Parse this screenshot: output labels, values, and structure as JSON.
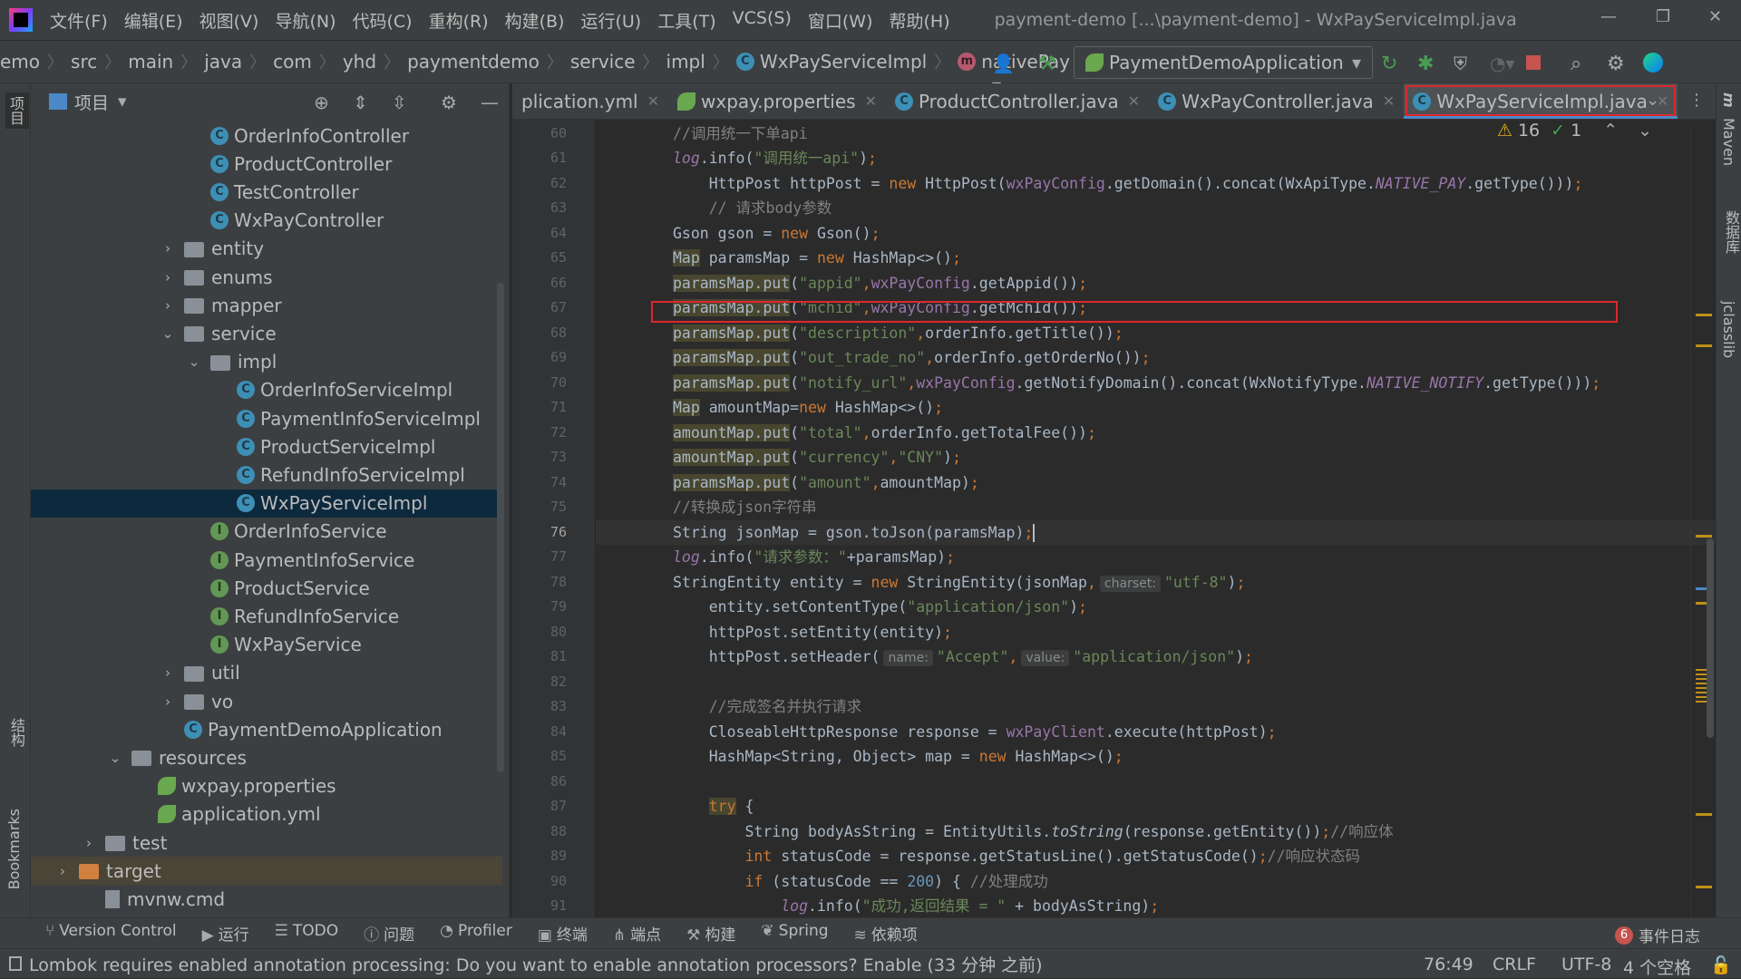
{
  "menubar": {
    "items": [
      "文件(F)",
      "编辑(E)",
      "视图(V)",
      "导航(N)",
      "代码(C)",
      "重构(R)",
      "构建(B)",
      "运行(U)",
      "工具(T)",
      "VCS(S)",
      "窗口(W)",
      "帮助(H)"
    ],
    "title": "payment-demo [...\\payment-demo] - WxPayServiceImpl.java"
  },
  "breadcrumb": {
    "items": [
      "emo",
      "src",
      "main",
      "java",
      "com",
      "yhd",
      "paymentdemo",
      "service",
      "impl"
    ],
    "class_name": "WxPayServiceImpl",
    "method_name": "nativePay"
  },
  "toolbar": {
    "run_config": "PaymentDemoApplication"
  },
  "project_panel": {
    "title": "项目",
    "tree": [
      {
        "label": "OrderInfoController",
        "icon": "class",
        "level": 6
      },
      {
        "label": "ProductController",
        "icon": "class",
        "level": 6
      },
      {
        "label": "TestController",
        "icon": "class",
        "level": 6
      },
      {
        "label": "WxPayController",
        "icon": "class",
        "level": 6
      },
      {
        "label": "entity",
        "icon": "folder",
        "level": 5,
        "arrow": "collapsed"
      },
      {
        "label": "enums",
        "icon": "folder",
        "level": 5,
        "arrow": "collapsed"
      },
      {
        "label": "mapper",
        "icon": "folder",
        "level": 5,
        "arrow": "collapsed"
      },
      {
        "label": "service",
        "icon": "folder",
        "level": 5,
        "arrow": "expanded"
      },
      {
        "label": "impl",
        "icon": "folder",
        "level": 6,
        "arrow": "expanded"
      },
      {
        "label": "OrderInfoServiceImpl",
        "icon": "class",
        "level": 7
      },
      {
        "label": "PaymentInfoServiceImpl",
        "icon": "class",
        "level": 7
      },
      {
        "label": "ProductServiceImpl",
        "icon": "class",
        "level": 7
      },
      {
        "label": "RefundInfoServiceImpl",
        "icon": "class",
        "level": 7
      },
      {
        "label": "WxPayServiceImpl",
        "icon": "class",
        "level": 7,
        "selected": true
      },
      {
        "label": "OrderInfoService",
        "icon": "interface",
        "level": 6
      },
      {
        "label": "PaymentInfoService",
        "icon": "interface",
        "level": 6
      },
      {
        "label": "ProductService",
        "icon": "interface",
        "level": 6
      },
      {
        "label": "RefundInfoService",
        "icon": "interface",
        "level": 6
      },
      {
        "label": "WxPayService",
        "icon": "interface",
        "level": 6
      },
      {
        "label": "util",
        "icon": "folder",
        "level": 5,
        "arrow": "collapsed"
      },
      {
        "label": "vo",
        "icon": "folder",
        "level": 5,
        "arrow": "collapsed"
      },
      {
        "label": "PaymentDemoApplication",
        "icon": "spring-app",
        "level": 5
      },
      {
        "label": "resources",
        "icon": "folder",
        "level": 3,
        "arrow": "expanded"
      },
      {
        "label": "wxpay.properties",
        "icon": "spring-config",
        "level": 4
      },
      {
        "label": "application.yml",
        "icon": "spring-config",
        "level": 4
      },
      {
        "label": "test",
        "icon": "folder",
        "level": 2,
        "arrow": "collapsed"
      },
      {
        "label": "target",
        "icon": "folder-excluded",
        "level": 1,
        "arrow": "collapsed",
        "excluded": true
      },
      {
        "label": "mvnw.cmd",
        "icon": "file",
        "level": 2
      }
    ]
  },
  "tabs": [
    {
      "label": "plication.yml",
      "icon": "none"
    },
    {
      "label": "wxpay.properties",
      "icon": "spring-config"
    },
    {
      "label": "ProductController.java",
      "icon": "class"
    },
    {
      "label": "WxPayController.java",
      "icon": "class"
    },
    {
      "label": "WxPayServiceImpl.java",
      "icon": "class",
      "active": true
    }
  ],
  "editor": {
    "warnings": "16",
    "weak_warnings": "1",
    "current_line": 76,
    "highlighted_line": 70,
    "lines": [
      {
        "n": 60,
        "seg": [
          [
            "c",
            "//调用统一下单api"
          ]
        ]
      },
      {
        "n": 61,
        "seg": [
          [
            "fi",
            "log"
          ],
          [
            "p",
            ".info("
          ],
          [
            "s",
            "\"调用统一api\""
          ],
          [
            "p",
            ")"
          ],
          [
            "k",
            ";"
          ]
        ]
      },
      {
        "n": 62,
        "seg": [
          [
            "p",
            "    HttpPost httpPost = "
          ],
          [
            "k",
            "new"
          ],
          [
            "p",
            " HttpPost("
          ],
          [
            "f",
            "wxPayConfig"
          ],
          [
            "p",
            ".getDomain().concat(WxApiType."
          ],
          [
            "fi",
            "NATIVE_PAY"
          ],
          [
            "p",
            ".getType()))"
          ],
          [
            "k",
            ";"
          ]
        ]
      },
      {
        "n": 63,
        "seg": [
          [
            "c",
            "    // 请求body参数"
          ]
        ]
      },
      {
        "n": 64,
        "seg": [
          [
            "p",
            "Gson gson = "
          ],
          [
            "k",
            "new"
          ],
          [
            "p",
            " Gson()"
          ],
          [
            "k",
            ";"
          ]
        ]
      },
      {
        "n": 65,
        "seg": [
          [
            "hl",
            "Map"
          ],
          [
            "p",
            " paramsMap = "
          ],
          [
            "k",
            "new"
          ],
          [
            "p",
            " HashMap<>()"
          ],
          [
            "k",
            ";"
          ]
        ]
      },
      {
        "n": 66,
        "seg": [
          [
            "hl",
            "paramsMap.put"
          ],
          [
            "p",
            "("
          ],
          [
            "s",
            "\"appid\""
          ],
          [
            "k",
            ","
          ],
          [
            "f",
            "wxPayConfig"
          ],
          [
            "p",
            ".getAppid())"
          ],
          [
            "k",
            ";"
          ]
        ]
      },
      {
        "n": 67,
        "seg": [
          [
            "hl",
            "paramsMap.put"
          ],
          [
            "p",
            "("
          ],
          [
            "s",
            "\"mchid\""
          ],
          [
            "k",
            ","
          ],
          [
            "f",
            "wxPayConfig"
          ],
          [
            "p",
            ".getMchId())"
          ],
          [
            "k",
            ";"
          ]
        ]
      },
      {
        "n": 68,
        "seg": [
          [
            "hl",
            "paramsMap.put"
          ],
          [
            "p",
            "("
          ],
          [
            "s",
            "\"description\""
          ],
          [
            "k",
            ","
          ],
          [
            "p",
            "orderInfo.getTitle())"
          ],
          [
            "k",
            ";"
          ]
        ]
      },
      {
        "n": 69,
        "seg": [
          [
            "hl",
            "paramsMap.put"
          ],
          [
            "p",
            "("
          ],
          [
            "s",
            "\"out_trade_no\""
          ],
          [
            "k",
            ","
          ],
          [
            "p",
            "orderInfo.getOrderNo())"
          ],
          [
            "k",
            ";"
          ]
        ]
      },
      {
        "n": 70,
        "seg": [
          [
            "hl",
            "paramsMap.put"
          ],
          [
            "p",
            "("
          ],
          [
            "s",
            "\"notify_url\""
          ],
          [
            "k",
            ","
          ],
          [
            "f",
            "wxPayConfig"
          ],
          [
            "p",
            ".getNotifyDomain().concat(WxNotifyType."
          ],
          [
            "fi",
            "NATIVE_NOTIFY"
          ],
          [
            "p",
            ".getType()))"
          ],
          [
            "k",
            ";"
          ]
        ]
      },
      {
        "n": 71,
        "seg": [
          [
            "hl",
            "Map"
          ],
          [
            "p",
            " amountMap="
          ],
          [
            "k",
            "new"
          ],
          [
            "p",
            " HashMap<>()"
          ],
          [
            "k",
            ";"
          ]
        ]
      },
      {
        "n": 72,
        "seg": [
          [
            "hl",
            "amountMap.put"
          ],
          [
            "p",
            "("
          ],
          [
            "s",
            "\"total\""
          ],
          [
            "k",
            ","
          ],
          [
            "p",
            "orderInfo.getTotalFee())"
          ],
          [
            "k",
            ";"
          ]
        ]
      },
      {
        "n": 73,
        "seg": [
          [
            "hl",
            "amountMap.put"
          ],
          [
            "p",
            "("
          ],
          [
            "s",
            "\"currency\""
          ],
          [
            "k",
            ","
          ],
          [
            "s",
            "\"CNY\""
          ],
          [
            "p",
            ")"
          ],
          [
            "k",
            ";"
          ]
        ]
      },
      {
        "n": 74,
        "seg": [
          [
            "hl",
            "paramsMap.put"
          ],
          [
            "p",
            "("
          ],
          [
            "s",
            "\"amount\""
          ],
          [
            "k",
            ","
          ],
          [
            "p",
            "amountMap)"
          ],
          [
            "k",
            ";"
          ]
        ]
      },
      {
        "n": 75,
        "seg": [
          [
            "c",
            "//转换成json字符串"
          ]
        ]
      },
      {
        "n": 76,
        "seg": [
          [
            "p",
            "String jsonMap = gson.toJson(paramsMap)"
          ],
          [
            "k",
            ";"
          ]
        ]
      },
      {
        "n": 77,
        "seg": [
          [
            "fi",
            "log"
          ],
          [
            "p",
            ".info("
          ],
          [
            "s",
            "\"请求参数：\""
          ],
          [
            "p",
            "+paramsMap)"
          ],
          [
            "k",
            ";"
          ]
        ]
      },
      {
        "n": 78,
        "seg": [
          [
            "p",
            "StringEntity entity = "
          ],
          [
            "k",
            "new"
          ],
          [
            "p",
            " StringEntity(jsonMap"
          ],
          [
            "k",
            ","
          ],
          [
            "h",
            "charset:"
          ],
          [
            "s",
            "\"utf-8\""
          ],
          [
            "p",
            ")"
          ],
          [
            "k",
            ";"
          ]
        ]
      },
      {
        "n": 79,
        "seg": [
          [
            "p",
            "    entity.setContentType("
          ],
          [
            "s",
            "\"application/json\""
          ],
          [
            "p",
            ")"
          ],
          [
            "k",
            ";"
          ]
        ]
      },
      {
        "n": 80,
        "seg": [
          [
            "p",
            "    httpPost.setEntity(entity)"
          ],
          [
            "k",
            ";"
          ]
        ]
      },
      {
        "n": 81,
        "seg": [
          [
            "p",
            "    httpPost.setHeader("
          ],
          [
            "h",
            "name:"
          ],
          [
            "s",
            "\"Accept\""
          ],
          [
            "k",
            ","
          ],
          [
            "h",
            "value:"
          ],
          [
            "s",
            "\"application/json\""
          ],
          [
            "p",
            ")"
          ],
          [
            "k",
            ";"
          ]
        ]
      },
      {
        "n": 82,
        "seg": []
      },
      {
        "n": 83,
        "seg": [
          [
            "c",
            "    //完成签名并执行请求"
          ]
        ]
      },
      {
        "n": 84,
        "seg": [
          [
            "p",
            "    CloseableHttpResponse response = "
          ],
          [
            "f",
            "wxPayClient"
          ],
          [
            "p",
            ".execute(httpPost)"
          ],
          [
            "k",
            ";"
          ]
        ]
      },
      {
        "n": 85,
        "seg": [
          [
            "p",
            "    HashMap<String, Object> map = "
          ],
          [
            "k",
            "new"
          ],
          [
            "p",
            " HashMap<>()"
          ],
          [
            "k",
            ";"
          ]
        ]
      },
      {
        "n": 86,
        "seg": []
      },
      {
        "n": 87,
        "seg": [
          [
            "p",
            "    "
          ],
          [
            "hlk",
            "try"
          ],
          [
            "p",
            " {"
          ]
        ]
      },
      {
        "n": 88,
        "seg": [
          [
            "p",
            "        String bodyAsString = EntityUtils."
          ],
          [
            "i",
            "toString"
          ],
          [
            "p",
            "(response.getEntity())"
          ],
          [
            "k",
            ";"
          ],
          [
            "c",
            "//响应体"
          ]
        ]
      },
      {
        "n": 89,
        "seg": [
          [
            "p",
            "        "
          ],
          [
            "k",
            "int"
          ],
          [
            "p",
            " statusCode = response.getStatusLine().getStatusCode()"
          ],
          [
            "k",
            ";"
          ],
          [
            "c",
            "//响应状态码"
          ]
        ]
      },
      {
        "n": 90,
        "seg": [
          [
            "p",
            "        "
          ],
          [
            "k",
            "if"
          ],
          [
            "p",
            " (statusCode == "
          ],
          [
            "n",
            "200"
          ],
          [
            "p",
            ") { "
          ],
          [
            "c",
            "//处理成功"
          ]
        ]
      },
      {
        "n": 91,
        "seg": [
          [
            "p",
            "            "
          ],
          [
            "fi",
            "log"
          ],
          [
            "p",
            ".info("
          ],
          [
            "s",
            "\"成功,返回结果 = \""
          ],
          [
            "p",
            " + bodyAsString)"
          ],
          [
            "k",
            ";"
          ]
        ]
      }
    ]
  },
  "left_stripe": [
    "项目",
    "结构",
    "Bookmarks"
  ],
  "right_stripe": [
    "Maven",
    "数据库",
    "jclasslib"
  ],
  "tool_windows": [
    {
      "label": "Version Control",
      "icon": "branch-icon"
    },
    {
      "label": "运行",
      "icon": "run-icon"
    },
    {
      "label": "TODO",
      "icon": "list-icon"
    },
    {
      "label": "问题",
      "icon": "problems-icon"
    },
    {
      "label": "Profiler",
      "icon": "profiler-icon"
    },
    {
      "label": "终端",
      "icon": "terminal-icon"
    },
    {
      "label": "端点",
      "icon": "endpoints-icon"
    },
    {
      "label": "构建",
      "icon": "hammer-icon"
    },
    {
      "label": "Spring",
      "icon": "spring-icon"
    },
    {
      "label": "依赖项",
      "icon": "layers-icon"
    }
  ],
  "event_log": {
    "count": "6",
    "label": "事件日志"
  },
  "status": {
    "message": "Lombok requires enabled annotation processing: Do you want to enable annotation processors? Enable (33 分钟 之前)",
    "position": "76:49",
    "line_sep": "CRLF",
    "encoding": "UTF-8",
    "indent": "4 个空格"
  },
  "colors": {
    "accent": "#4a88c7",
    "highlight_box": "#e0262b",
    "selection": "#0d293e",
    "keyword": "#cc7832",
    "string": "#6a8759",
    "field": "#9876aa",
    "comment": "#808080"
  }
}
